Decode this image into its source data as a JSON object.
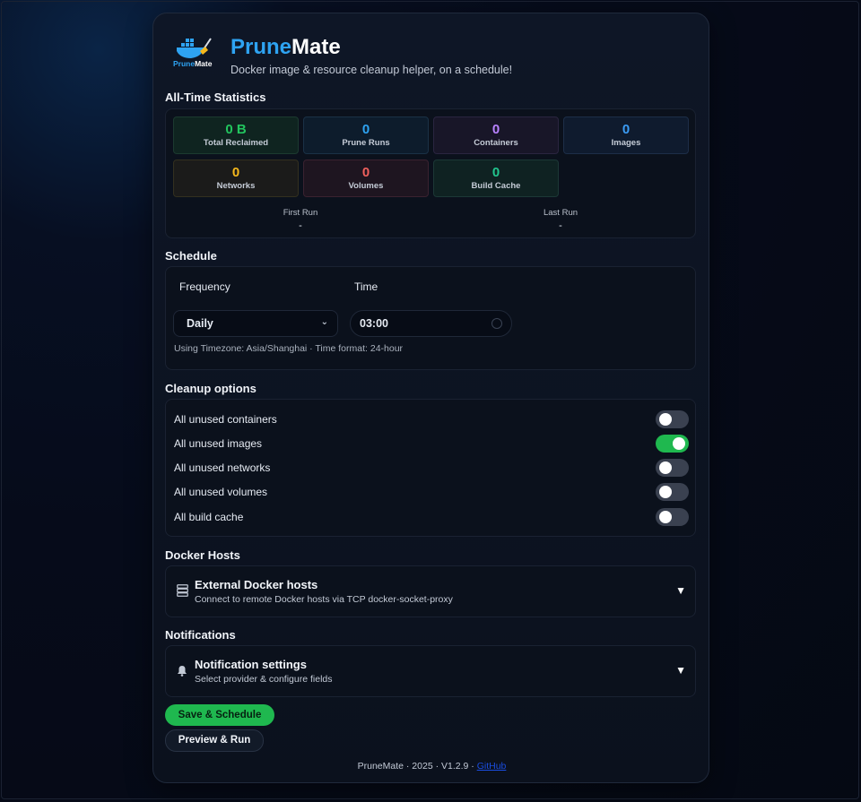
{
  "app": {
    "logo_text_prune": "Prune",
    "logo_text_mate": "Mate",
    "title_prune": "Prune",
    "title_mate": "Mate",
    "subtitle": "Docker image & resource cleanup helper, on a schedule!"
  },
  "stats": {
    "title": "All-Time Statistics",
    "items": [
      {
        "value": "0 B",
        "label": "Total Reclaimed",
        "color": "#22c55e"
      },
      {
        "value": "0",
        "label": "Prune Runs",
        "color": "#2ea3f2"
      },
      {
        "value": "0",
        "label": "Containers",
        "color": "#b983ff"
      },
      {
        "value": "0",
        "label": "Images",
        "color": "#3b9cf5"
      },
      {
        "value": "0",
        "label": "Networks",
        "color": "#f5b81c"
      },
      {
        "value": "0",
        "label": "Volumes",
        "color": "#f0605d"
      },
      {
        "value": "0",
        "label": "Build Cache",
        "color": "#22c58e"
      }
    ],
    "first_run_label": "First Run",
    "first_run_value": "-",
    "last_run_label": "Last Run",
    "last_run_value": "-"
  },
  "schedule": {
    "title": "Schedule",
    "frequency_label": "Frequency",
    "frequency_value": "Daily",
    "time_label": "Time",
    "time_value": "03:00",
    "timezone_note": "Using Timezone: Asia/Shanghai · Time format: 24-hour"
  },
  "cleanup": {
    "title": "Cleanup options",
    "options": [
      {
        "label": "All unused containers",
        "enabled": false
      },
      {
        "label": "All unused images",
        "enabled": true
      },
      {
        "label": "All unused networks",
        "enabled": false
      },
      {
        "label": "All unused volumes",
        "enabled": false
      },
      {
        "label": "All build cache",
        "enabled": false
      }
    ]
  },
  "docker_hosts": {
    "title": "Docker Hosts",
    "accordion_title": "External Docker hosts",
    "accordion_subtitle": "Connect to remote Docker hosts via TCP docker-socket-proxy",
    "icon": "server-icon"
  },
  "notifications": {
    "title": "Notifications",
    "accordion_title": "Notification settings",
    "accordion_subtitle": "Select provider & configure fields",
    "icon": "bell-icon"
  },
  "actions": {
    "save_label": "Save & Schedule",
    "preview_label": "Preview & Run"
  },
  "footer": {
    "text": "PruneMate · 2025 · V1.2.9 · ",
    "link_label": "GitHub"
  },
  "colors": {
    "accent_blue": "#2ea3f2",
    "toggle_on": "#1fb84f",
    "primary_button": "#1fb84f"
  }
}
